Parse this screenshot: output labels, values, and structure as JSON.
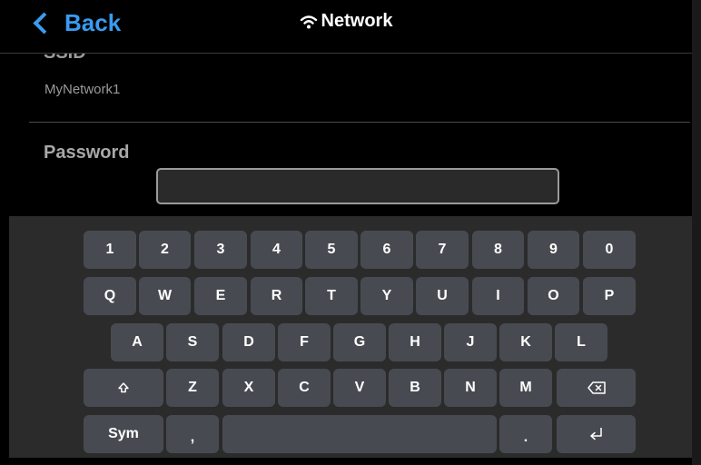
{
  "header": {
    "back_label": "Back",
    "title": "Network",
    "accent_color": "#3a9bf0",
    "title_icon": "wifi-icon"
  },
  "form": {
    "ssid_label": "SSID",
    "ssid_value": "MyNetwork1",
    "password_label": "Password",
    "password_value": ""
  },
  "keyboard": {
    "row1": [
      "1",
      "2",
      "3",
      "4",
      "5",
      "6",
      "7",
      "8",
      "9",
      "0"
    ],
    "row2": [
      "Q",
      "W",
      "E",
      "R",
      "T",
      "Y",
      "U",
      "I",
      "O",
      "P"
    ],
    "row3": [
      "A",
      "S",
      "D",
      "F",
      "G",
      "H",
      "J",
      "K",
      "L"
    ],
    "row4": [
      "Z",
      "X",
      "C",
      "V",
      "B",
      "N",
      "M"
    ],
    "shift_icon": "shift-icon",
    "backspace_icon": "backspace-icon",
    "sym_label": "Sym",
    "comma_label": ",",
    "period_label": ".",
    "enter_icon": "enter-icon",
    "key_color": "#474b51"
  }
}
